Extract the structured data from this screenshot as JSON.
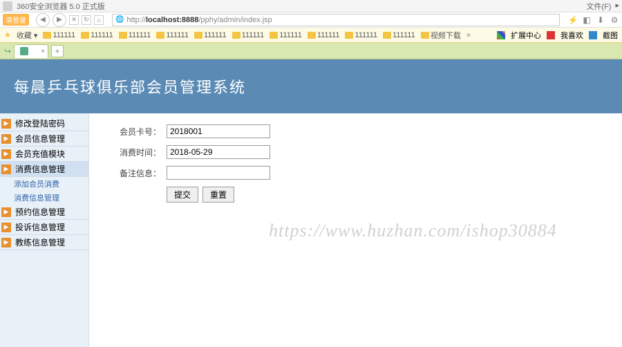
{
  "browser": {
    "title": "360安全浏览器 5.0 正式版",
    "menu_file": "文件(F)",
    "login_label": "请登录",
    "url_prefix": "http://",
    "url_host": "localhost:8888",
    "url_path": "/pphy/admin/index.jsp"
  },
  "bookmarks": {
    "fav_label": "收藏 ▾",
    "folders": [
      "111111",
      "111111",
      "111111",
      "111111",
      "111111",
      "111111",
      "111111",
      "111111",
      "111111",
      "111111",
      "视频下载"
    ],
    "ext_center": "扩展中心",
    "wo_xihuan": "我喜欢",
    "screenshot": "截图"
  },
  "tabs": {
    "active_tab": " ",
    "new_tab": "+"
  },
  "app": {
    "banner_title": "每晨乒乓球俱乐部会员管理系统"
  },
  "menu": {
    "items": [
      {
        "label": "修改登陆密码"
      },
      {
        "label": "会员信息管理"
      },
      {
        "label": "会员充值模块"
      },
      {
        "label": "消费信息管理",
        "active": true
      },
      {
        "label": "预约信息管理"
      },
      {
        "label": "投诉信息管理"
      },
      {
        "label": "教练信息管理"
      }
    ],
    "sub_items": [
      "添加会员消费",
      "消费信息管理"
    ]
  },
  "form": {
    "card_label": "会员卡号：",
    "card_value": "2018001",
    "time_label": "消费时间：",
    "time_value": "2018-05-29",
    "note_label": "备注信息：",
    "note_value": "",
    "submit": "提交",
    "reset": "重置"
  },
  "watermark": "https://www.huzhan.com/ishop30884"
}
